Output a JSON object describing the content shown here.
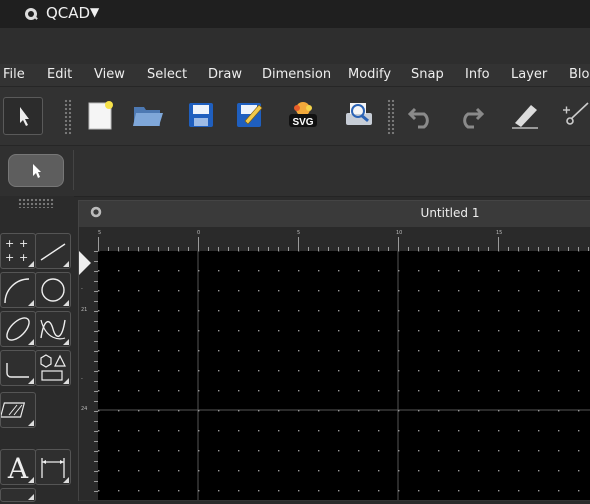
{
  "app": {
    "title": "QCAD"
  },
  "menu": [
    "File",
    "Edit",
    "View",
    "Select",
    "Draw",
    "Dimension",
    "Modify",
    "Snap",
    "Info",
    "Layer",
    "Blo"
  ],
  "toolbar": {
    "buttons": [
      "select-pointer",
      "new-document",
      "open-file",
      "save",
      "save-as",
      "export-svg",
      "print-preview",
      "undo",
      "redo",
      "pen",
      "cut"
    ],
    "svg_badge_label": "SVG"
  },
  "tools": {
    "text_glyph": "A"
  },
  "document": {
    "tab_title": "Untitled 1",
    "ruler_x_labels": [
      "5",
      "0",
      "5",
      "10",
      "15"
    ],
    "ruler_y_labels": [
      "-",
      "21",
      "-",
      "24"
    ]
  },
  "colors": {
    "canvas_bg": "#000000",
    "grid_dot": "#9a9a9a",
    "grid_line": "#555555"
  }
}
